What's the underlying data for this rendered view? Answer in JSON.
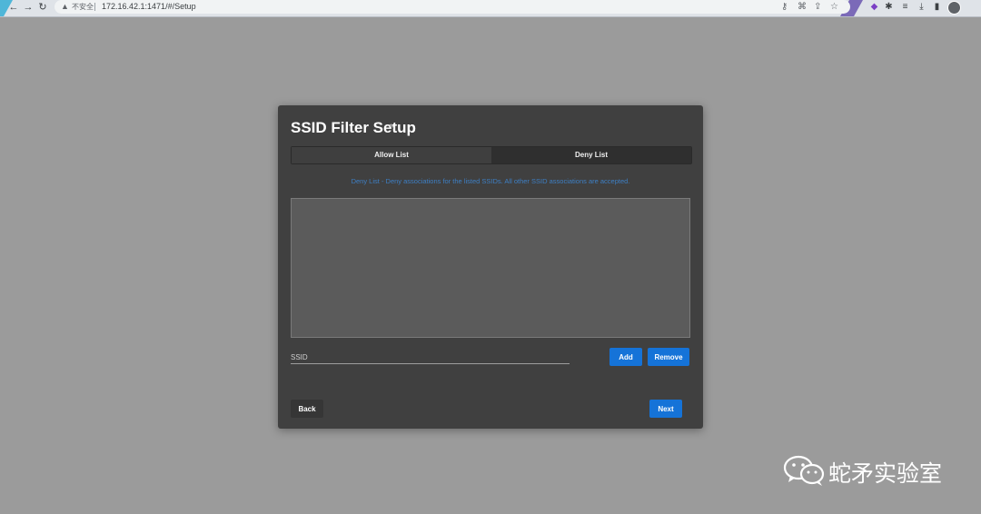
{
  "browser": {
    "url": "172.16.42.1:1471/#/Setup",
    "security_label": "不安全",
    "warning_icon": "warning-triangle-icon",
    "back_icon": "arrow-left-icon",
    "forward_icon": "arrow-right-icon",
    "reload_icon": "reload-icon"
  },
  "dialog": {
    "title": "SSID Filter Setup",
    "tabs": [
      {
        "label": "Allow List",
        "active": false
      },
      {
        "label": "Deny List",
        "active": true
      }
    ],
    "description": "Deny List - Deny associations for the listed SSIDs. All other SSID associations are accepted.",
    "ssid_placeholder": "SSID",
    "ssid_value": "",
    "add_label": "Add",
    "remove_label": "Remove",
    "back_label": "Back",
    "next_label": "Next"
  },
  "watermark": {
    "text": "蛇矛实验室"
  },
  "colors": {
    "page_background": "#9b9b9b",
    "dialog_background": "#404040",
    "primary_button": "#1573d8",
    "description_text": "#3d7fc4",
    "listbox": "#5b5b5b"
  }
}
